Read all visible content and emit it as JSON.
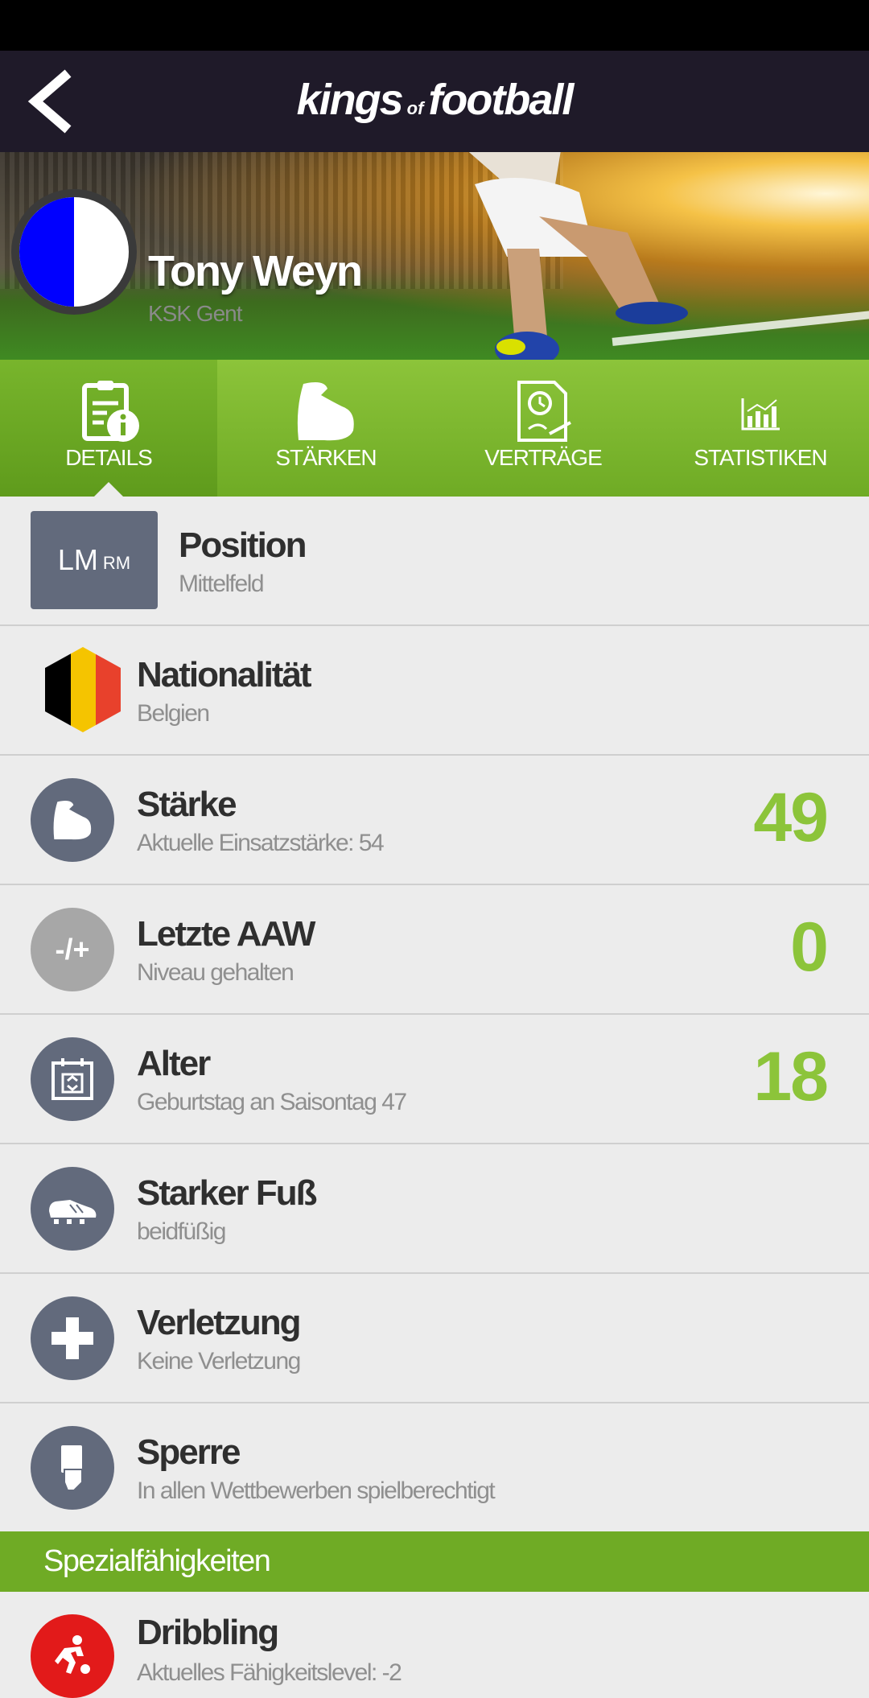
{
  "app": {
    "logo_part1": "kings",
    "logo_of": "of",
    "logo_part2": "football"
  },
  "player": {
    "name": "Tony Weyn",
    "club": "KSK Gent"
  },
  "tabs": [
    {
      "label": "DETAILS",
      "icon": "clipboard-info-icon",
      "active": true
    },
    {
      "label": "STÄRKEN",
      "icon": "bicep-icon",
      "active": false
    },
    {
      "label": "VERTRÄGE",
      "icon": "contract-icon",
      "active": false
    },
    {
      "label": "STATISTIKEN",
      "icon": "bar-chart-icon",
      "active": false
    }
  ],
  "rows": {
    "position": {
      "title": "Position",
      "sub": "Mittelfeld",
      "main": "LM",
      "alt": "RM"
    },
    "nationality": {
      "title": "Nationalität",
      "sub": "Belgien"
    },
    "strength": {
      "title": "Stärke",
      "sub": "Aktuelle Einsatzstärke: 54",
      "value": "49"
    },
    "last_aaw": {
      "title": "Letzte AAW",
      "sub": "Niveau gehalten",
      "value": "0",
      "icon_text": "-/+"
    },
    "age": {
      "title": "Alter",
      "sub": "Geburtstag an Saisontag 47",
      "value": "18"
    },
    "foot": {
      "title": "Starker Fuß",
      "sub": "beidfüßig"
    },
    "injury": {
      "title": "Verletzung",
      "sub": "Keine Verletzung"
    },
    "suspension": {
      "title": "Sperre",
      "sub": "In allen Wettbewerben spielberechtigt"
    }
  },
  "special": {
    "section_title": "Spezialfähigkeiten",
    "items": [
      {
        "title": "Dribbling",
        "sub": "Aktuelles Fähigkeitslevel: -2"
      }
    ]
  },
  "colors": {
    "accent": "#8cc43a",
    "header": "#1f1a29",
    "icon_bg": "#626a7c",
    "skill_red": "#e21a1a"
  }
}
